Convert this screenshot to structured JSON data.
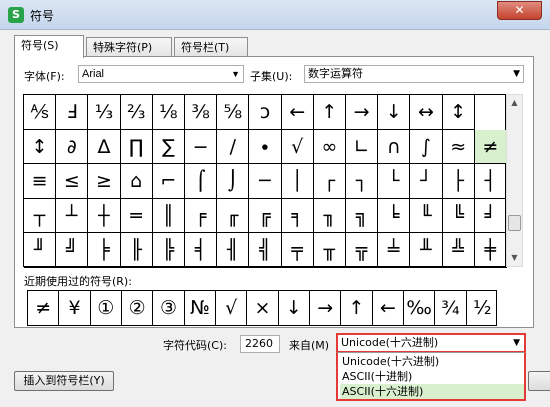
{
  "window": {
    "title": "符号",
    "icon_letter": "S",
    "close_glyph": "✕"
  },
  "tabs": [
    {
      "label": "符号(S)",
      "active": true
    },
    {
      "label": "特殊字符(P)",
      "active": false
    },
    {
      "label": "符号栏(T)",
      "active": false
    }
  ],
  "font": {
    "label": "字体(F):",
    "value": "Arial"
  },
  "subset": {
    "label": "子集(U):",
    "value": "数字运算符"
  },
  "symbols": [
    [
      "⅍",
      "Ⅎ",
      "⅓",
      "⅔",
      "⅛",
      "⅜",
      "⅝",
      "ↄ",
      "←",
      "↑",
      "→",
      "↓",
      "↔",
      "↕"
    ],
    [
      "↕",
      "∂",
      "∆",
      "∏",
      "∑",
      "−",
      "∕",
      "∙",
      "√",
      "∞",
      "∟",
      "∩",
      "∫",
      "≈",
      "≠"
    ],
    [
      "≡",
      "≤",
      "≥",
      "⌂",
      "⌐",
      "⌠",
      "⌡",
      "─",
      "│",
      "┌",
      "┐",
      "└",
      "┘",
      "├",
      "┤"
    ],
    [
      "┬",
      "┴",
      "┼",
      "═",
      "║",
      "╒",
      "╓",
      "╔",
      "╕",
      "╖",
      "╗",
      "╘",
      "╙",
      "╚",
      "╛"
    ],
    [
      "╜",
      "╝",
      "╞",
      "╟",
      "╠",
      "╡",
      "╢",
      "╣",
      "╤",
      "╥",
      "╦",
      "╧",
      "╨",
      "╩",
      "╪"
    ]
  ],
  "selected_symbol": "≠",
  "recent": {
    "label": "近期使用过的符号(R):",
    "items": [
      "≠",
      "¥",
      "①",
      "②",
      "③",
      "№",
      "√",
      "×",
      "↓",
      "→",
      "↑",
      "←",
      "‰",
      "¾",
      "½"
    ]
  },
  "code": {
    "label": "字符代码(C):",
    "value": "2260",
    "from_label": "来自(M)",
    "from_value": "Unicode(十六进制)"
  },
  "from_options": [
    "Unicode(十六进制)",
    "ASCII(十进制)",
    "ASCII(十六进制)"
  ],
  "highlighted_option": 2,
  "buttons": {
    "insert_to_bar": "插入到符号栏(Y)"
  }
}
